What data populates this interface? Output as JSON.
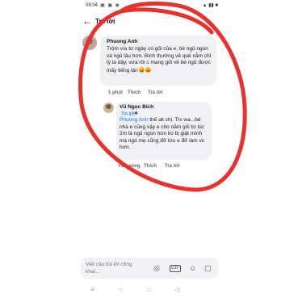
{
  "status_bar": {
    "time": "09:04",
    "left_icons": "▣ ▣ ◉",
    "right_icons": "▲ ▮▮ ■"
  },
  "header": {
    "title": "Trả lời",
    "back_icon": "arrow-left-icon"
  },
  "comments": [
    {
      "author": "Phuong Anh",
      "text": "Trộm vía từ ngày có gối của e, bé ngủ ngon và ngủ lâu hơn. Bình thường về quê nằm chỉ tý là dậy, vừa rồi c mang gối về bé ngủ được mấy tiếng lận",
      "emoji": "smiling-face-with-hearts",
      "time": "1 phút",
      "like": "Thích",
      "reply": "Trả lời"
    },
    {
      "author": "Vũ Ngọc Bích",
      "badge": "Tác giả",
      "badge_icon": "star-icon",
      "mention": "Phuong Anh",
      "text": " thế ak chị. Trv wa...bé nhà e cũng vậy e cho nằm gối từ lúc 2m là ngủ ngon hơn ko bị giật mình mà ngủ mẹ cũng đỡ lừu e đỡ làm vc hơn.",
      "time": "Vừa xong",
      "like": "Thích",
      "reply": "Trả lời"
    }
  ],
  "input": {
    "placeholder": "Viết câu trả lời công khai...",
    "icons": [
      "camera-icon",
      "gif-icon",
      "emoji-icon",
      "sticker-icon"
    ]
  },
  "annotation": {
    "color": "#e8322e"
  },
  "colors": {
    "link_blue": "#1b74e4",
    "bubble_gray": "#eff1f4"
  }
}
